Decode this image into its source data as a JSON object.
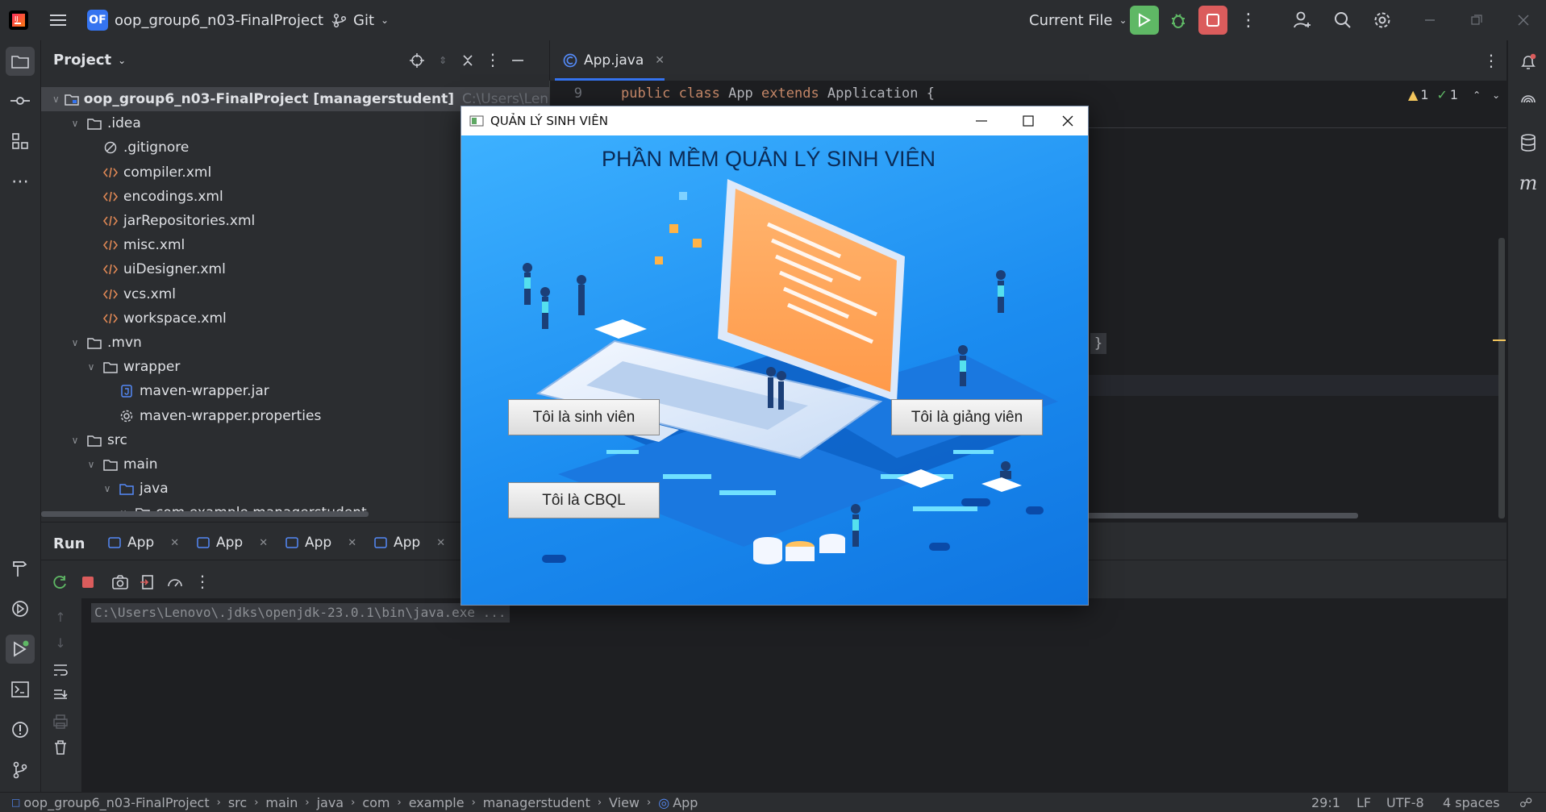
{
  "titlebar": {
    "project_badge": "OF",
    "project_name": "oop_group6_n03-FinalProject",
    "vcs_label": "Git",
    "run_config": "Current File",
    "icons": [
      "main-menu-icon",
      "run-icon",
      "debug-icon",
      "stop-icon",
      "more-icon",
      "add-user-icon",
      "search-icon",
      "settings-icon",
      "minimize-icon",
      "restore-icon",
      "close-icon"
    ]
  },
  "project_panel": {
    "title": "Project",
    "tree": [
      {
        "label": "oop_group6_n03-FinalProject [managerstudent]",
        "hint": "C:\\Users\\Lenovo\\Dow",
        "type": "module",
        "depth": 0,
        "expanded": true
      },
      {
        "label": ".idea",
        "type": "folder",
        "depth": 1,
        "expanded": true
      },
      {
        "label": ".gitignore",
        "type": "ignore",
        "depth": 2
      },
      {
        "label": "compiler.xml",
        "type": "xml",
        "depth": 2
      },
      {
        "label": "encodings.xml",
        "type": "xml",
        "depth": 2
      },
      {
        "label": "jarRepositories.xml",
        "type": "xml",
        "depth": 2
      },
      {
        "label": "misc.xml",
        "type": "xml",
        "depth": 2
      },
      {
        "label": "uiDesigner.xml",
        "type": "xml",
        "depth": 2
      },
      {
        "label": "vcs.xml",
        "type": "xml",
        "depth": 2
      },
      {
        "label": "workspace.xml",
        "type": "xml",
        "depth": 2
      },
      {
        "label": ".mvn",
        "type": "folder",
        "depth": 1,
        "expanded": true
      },
      {
        "label": "wrapper",
        "type": "folder",
        "depth": 2,
        "expanded": true
      },
      {
        "label": "maven-wrapper.jar",
        "type": "jar",
        "depth": 3
      },
      {
        "label": "maven-wrapper.properties",
        "type": "properties",
        "depth": 3
      },
      {
        "label": "src",
        "type": "folder",
        "depth": 1,
        "expanded": true
      },
      {
        "label": "main",
        "type": "folder",
        "depth": 2,
        "expanded": true
      },
      {
        "label": "java",
        "type": "source",
        "depth": 3,
        "expanded": true
      },
      {
        "label": "com.example.managerstudent",
        "type": "package",
        "depth": 4,
        "expanded": true
      }
    ]
  },
  "editor": {
    "tab_label": "App.java",
    "line_number": "9",
    "code_tokens": [
      {
        "t": "public ",
        "c": "#cf8e6d"
      },
      {
        "t": "class ",
        "c": "#cf8e6d"
      },
      {
        "t": "App ",
        "c": "#bcbec4"
      },
      {
        "t": "extends ",
        "c": "#cf8e6d"
      },
      {
        "t": "Application {",
        "c": "#bcbec4"
      }
    ],
    "warnings": "1",
    "oks": "1",
    "brace": "}"
  },
  "run_panel": {
    "title": "Run",
    "tabs": [
      "App",
      "App",
      "App",
      "App"
    ],
    "console_line": "C:\\Users\\Lenovo\\.jdks\\openjdk-23.0.1\\bin\\java.exe ..."
  },
  "status_bar": {
    "breadcrumbs": [
      "oop_group6_n03-FinalProject",
      "src",
      "main",
      "java",
      "com",
      "example",
      "managerstudent",
      "View",
      "App"
    ],
    "position": "29:1",
    "line_sep": "LF",
    "encoding": "UTF-8",
    "indent": "4 spaces"
  },
  "dialog": {
    "title": "QUẢN LÝ SINH VIÊN",
    "heading": "PHẦN MỀM QUẢN LÝ SINH VIÊN",
    "btn_student": "Tôi là sinh viên",
    "btn_teacher": "Tôi là giảng viên",
    "btn_admin": "Tôi là CBQL"
  },
  "colors": {
    "accent": "#3574f0",
    "run_green": "#5fb865",
    "stop_red": "#db5c5c",
    "dialog_blue": "#1b8cf0",
    "laptop_screen": "#ffa45c"
  }
}
